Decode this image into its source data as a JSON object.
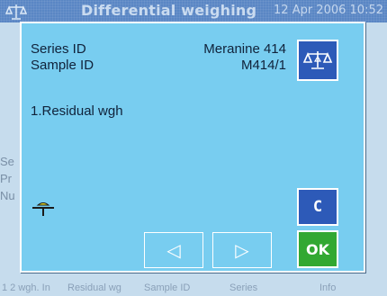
{
  "app": {
    "title": "Differential weighing",
    "datetime": "12 Apr 2006 10:52"
  },
  "background": {
    "left_fragments": [
      "Se",
      "Pr",
      "Nu"
    ],
    "softkeys": [
      "1 2 wgh. In",
      "Residual wg",
      "Sample ID",
      "Series",
      "Info"
    ]
  },
  "dialog": {
    "series_label": "Series ID",
    "series_value": "Meranine 414",
    "sample_label": "Sample ID",
    "sample_value": "M414/1",
    "step_label": "1.Residual wgh",
    "c_label": "C",
    "ok_label": "OK",
    "prev_arrow": "◁",
    "next_arrow": "▷"
  },
  "colors": {
    "dialog_bg": "#78cdf0",
    "button_blue": "#2d5ab8",
    "ok_green": "#32a832",
    "stability_yellow": "#f0e020"
  },
  "icons": {
    "balance": "balance-scale-icon",
    "stability": "stability-indicator-icon",
    "prev": "arrow-left-icon",
    "next": "arrow-right-icon"
  }
}
